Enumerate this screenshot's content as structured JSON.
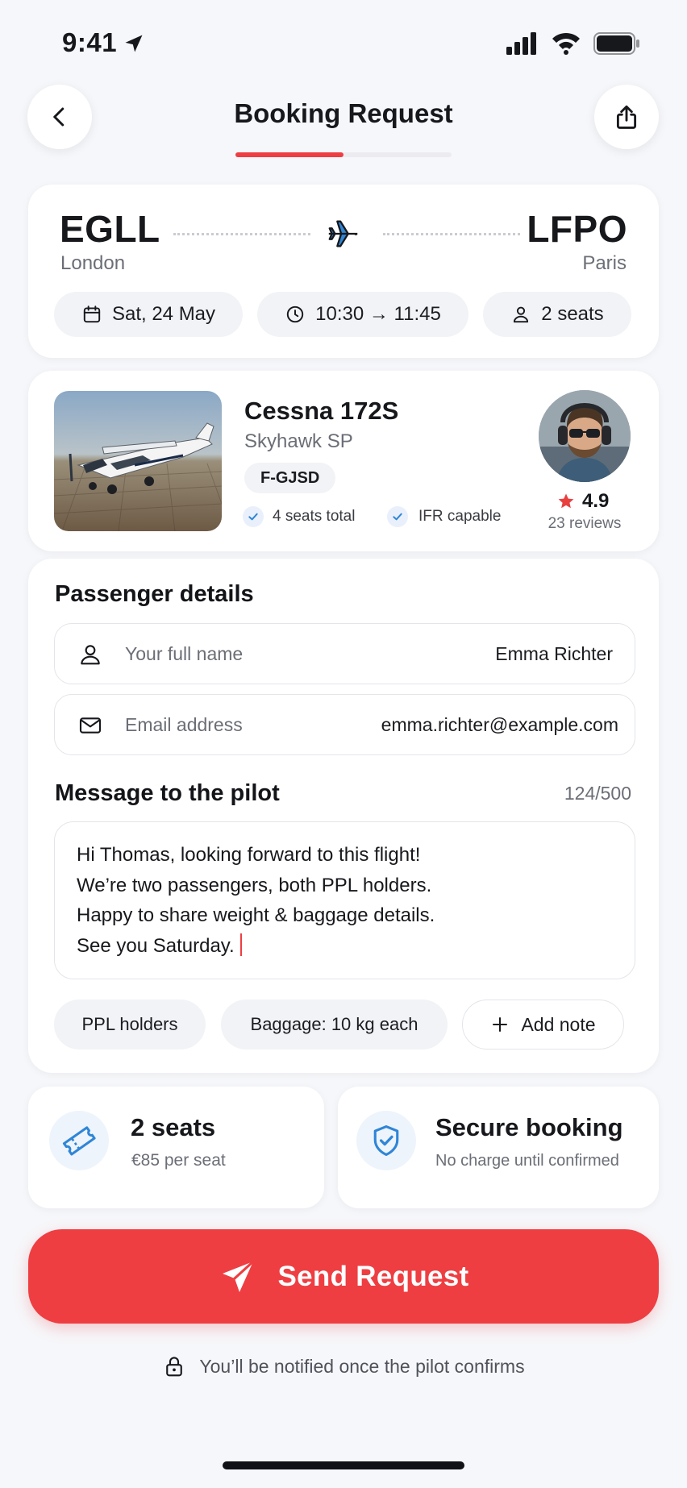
{
  "status_bar": {
    "time": "9:41"
  },
  "header": {
    "title": "Booking Request",
    "progress": 0.5
  },
  "route": {
    "origin_code": "EGLL",
    "origin_city": "London",
    "destination_code": "LFPO",
    "destination_city": "Paris",
    "date": "Sat, 24 May",
    "time": "10:30 → 11:45",
    "seats": "2 seats"
  },
  "aircraft": {
    "model": "Cessna 172S",
    "variant": "Skyhawk SP",
    "registration": "F-GJSD",
    "features": [
      "4 seats total",
      "IFR capable"
    ]
  },
  "pilot": {
    "rating": "4.9",
    "reviews": "23 reviews",
    "star_color": "#e8403f"
  },
  "passenger": {
    "section_title": "Passenger details",
    "name_placeholder": "Your full name",
    "name_value": "Emma Richter",
    "email_placeholder": "Email address",
    "email_value": "emma.richter@example.com"
  },
  "message": {
    "section_title": "Message to the pilot",
    "counter": "124/500",
    "lines": [
      "Hi Thomas, looking forward to this flight!",
      "We’re two passengers, both PPL holders.",
      "Happy to share weight & baggage details.",
      "See you Saturday."
    ],
    "chips": [
      "PPL holders",
      "Baggage: 10 kg each"
    ],
    "add_note_label": "Add note"
  },
  "summary": {
    "seats_title": "2 seats",
    "seats_price": "€85 per seat",
    "secure_title": "Secure booking",
    "secure_sub": "No charge until confirmed"
  },
  "cta": {
    "label": "Send Request",
    "color": "#ee3e42"
  },
  "footer": {
    "note": "You’ll be notified once the pilot confirms"
  },
  "colors": {
    "accent": "#ee3e42",
    "blue": "#2f86d6",
    "dark": "#17181c"
  }
}
